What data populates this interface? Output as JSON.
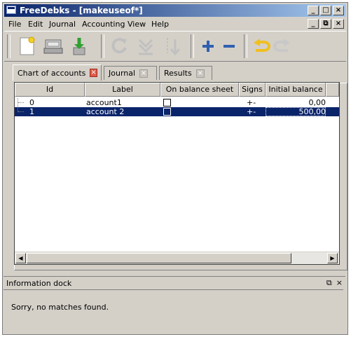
{
  "window": {
    "title": "FreeDebks - [makeuseof*]",
    "controls": {
      "minimize": "_",
      "maximize": "□",
      "close": "×"
    },
    "mdi_controls": {
      "minimize": "_",
      "restore": "⧉",
      "close": "×"
    }
  },
  "menu": [
    "File",
    "Edit",
    "Journal",
    "Accounting",
    "View",
    "Help"
  ],
  "toolbar": {
    "buttons": [
      "new-document",
      "open",
      "save",
      "refresh",
      "collapse",
      "expand",
      "add",
      "remove",
      "undo",
      "redo"
    ]
  },
  "tabs": [
    {
      "label": "Chart of accounts",
      "close": "×",
      "active": true
    },
    {
      "label": "Journal",
      "close": "×",
      "active": false
    },
    {
      "label": "Results",
      "close": "×",
      "active": false
    }
  ],
  "table": {
    "columns": [
      "Id",
      "Label",
      "On balance sheet",
      "Signs",
      "Initial balance"
    ],
    "rows": [
      {
        "id": "0",
        "label": "account1",
        "on_balance_sheet": false,
        "signs": "+-",
        "initial_balance": "0,00",
        "selected": false
      },
      {
        "id": "1",
        "label": "account 2",
        "on_balance_sheet": false,
        "signs": "+-",
        "initial_balance": "500,00",
        "selected": true
      }
    ]
  },
  "scrollbar": {
    "left_arrow": "◀",
    "right_arrow": "▶"
  },
  "dock": {
    "title": "Information dock",
    "float_icon": "⧉",
    "close_icon": "×",
    "message": "Sorry, no matches found."
  },
  "colors": {
    "selection": "#0a246a",
    "titlebar": "#0a246a",
    "tab_close_active": "#e0584a"
  }
}
